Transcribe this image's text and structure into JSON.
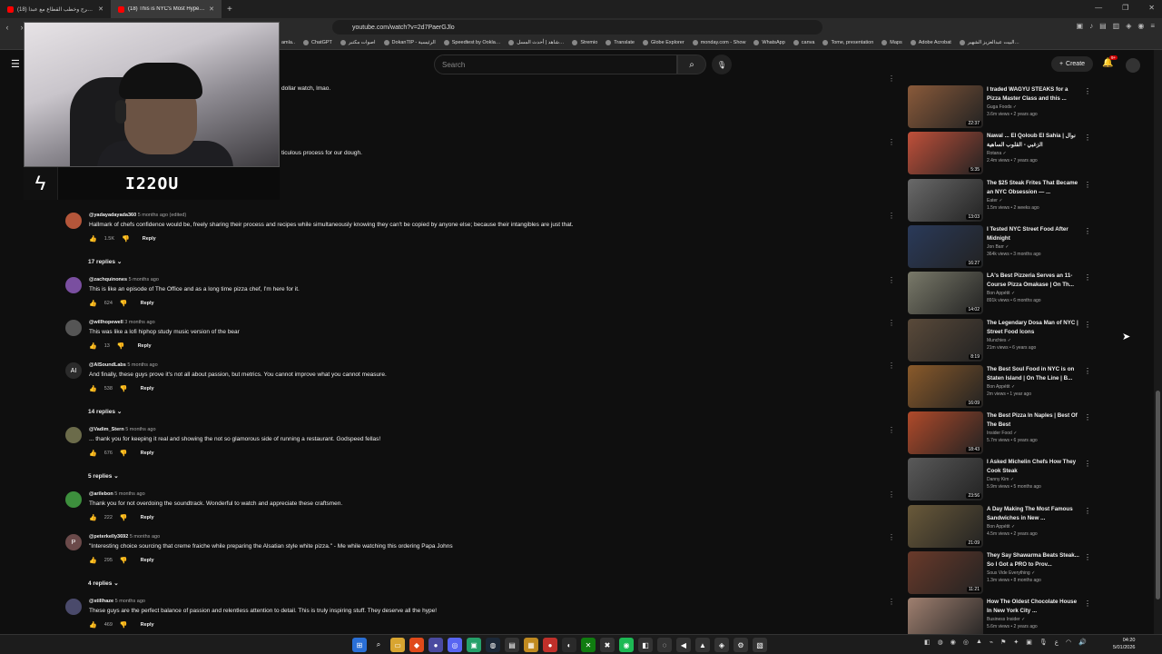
{
  "browser": {
    "tabs": [
      {
        "title": "(18) جديد بالمرج وخطب القطاع مع عبدا…",
        "active": false
      },
      {
        "title": "(18) This is NYC's Most Hyped P…",
        "active": true
      }
    ],
    "url": "youtube.com/watch?v=2d7PaerGJlo",
    "bookmarks": [
      "amla..",
      "ChatGPT",
      "اصوات مكتبر",
      "DokanTIP - الرئيسية",
      "Speedtest by Ookla…",
      "شاهد | أحدث المسل…",
      "Stremio",
      "Translate",
      "Globe Explorer",
      "monday.com - Show",
      "WhatsApp",
      "canva",
      "Tome, presentation",
      "Maps",
      "Adobe Acrobat",
      "البيت عبدالعزيز الشهير…"
    ]
  },
  "youtube": {
    "search_placeholder": "Search",
    "create_label": "Create",
    "notif_count": "9+"
  },
  "overlay": {
    "streamer_name": "I22OU"
  },
  "fragments": {
    "f1": "dollar watch, lmao.",
    "f2": "ticulous process for our dough."
  },
  "comments": [
    {
      "user": "@yadayadayada360",
      "meta": "5 months ago (edited)",
      "text": "Hallmark of chefs confidence would be, freely sharing their process and recipes while simultaneously knowing they can't be copied by anyone else; because their intangibles are just that.",
      "likes": "1.5K",
      "reply": "Reply",
      "replies": "17 replies",
      "avatar_color": "#b4563a",
      "initial": ""
    },
    {
      "user": "@zachquinones",
      "meta": "5 months ago",
      "text": "This is like an episode of The Office and as a long time pizza chef, I'm here for it.",
      "likes": "624",
      "reply": "Reply",
      "replies": "",
      "avatar_color": "#7a4fa0",
      "initial": ""
    },
    {
      "user": "@willhopewell",
      "meta": "3 months ago",
      "text": "This was like a lofi hiphop study music version of the bear",
      "likes": "13",
      "reply": "Reply",
      "replies": "",
      "avatar_color": "#555555",
      "initial": ""
    },
    {
      "user": "@AISoundLabs",
      "meta": "5 months ago",
      "text": "And finally, these guys prove it's not all about passion, but metrics. You cannot improve what you cannot measure.",
      "likes": "538",
      "reply": "Reply",
      "replies": "14 replies",
      "avatar_color": "#2b2b2b",
      "initial": "AI"
    },
    {
      "user": "@Vadim_Stern",
      "meta": "5 months ago",
      "text": "... thank you for keeping it real and showing the not so glamorous side of running a restaurant. Godspeed fellas!",
      "likes": "676",
      "reply": "Reply",
      "replies": "5 replies",
      "avatar_color": "#6b6b4a",
      "initial": ""
    },
    {
      "user": "@arilebon",
      "meta": "5 months ago",
      "text": "Thank you for not overdoing the soundtrack. Wonderful to watch and appreciate these craftsmen.",
      "likes": "222",
      "reply": "Reply",
      "replies": "",
      "avatar_color": "#3d8f3d",
      "initial": ""
    },
    {
      "user": "@peterkelly3692",
      "meta": "5 months ago",
      "text": "\"Interesting choice sourcing that creme fraiche while preparing the Alsatian style white pizza.\" - Me while watching this ordering Papa Johns",
      "likes": "295",
      "reply": "Reply",
      "replies": "4 replies",
      "avatar_color": "#6b4a4a",
      "initial": "P"
    },
    {
      "user": "@stillhaze",
      "meta": "5 months ago",
      "text": "These guys are the perfect balance of passion and relentless attention to detail. This is truly inspiring stuff. They deserve all the hype!",
      "likes": "469",
      "reply": "Reply",
      "replies": "",
      "avatar_color": "#4a4a6b",
      "initial": ""
    }
  ],
  "recommendations": [
    {
      "title": "I traded WAGYU STEAKS for a Pizza Master Class and this ...",
      "channel": "Guga Foods",
      "meta": "3.6m views • 2 years ago",
      "duration": "22:37",
      "color": "#8a5a3a"
    },
    {
      "title": "Nawal ... El Qoloub El Sahia | نوال الزغبي - القلوب الساهية",
      "channel": "Rotana",
      "meta": "2.4m views • 7 years ago",
      "duration": "5:35",
      "color": "#c0503a"
    },
    {
      "title": "The $25 Steak Frites That Became an NYC Obsession — ...",
      "channel": "Eater",
      "meta": "1.5m views • 2 weeks ago",
      "duration": "13:03",
      "color": "#6a6a6a"
    },
    {
      "title": "I Tested NYC Street Food After Midnight",
      "channel": "Jon Barr",
      "meta": "364k views • 3 months ago",
      "duration": "16:27",
      "color": "#2a3a5a"
    },
    {
      "title": "LA's Best Pizzeria Serves an 11-Course Pizza Omakase | On Th...",
      "channel": "Bon Appétit",
      "meta": "891k views • 6 months ago",
      "duration": "14:02",
      "color": "#7a7a6a"
    },
    {
      "title": "The Legendary Dosa Man of NYC | Street Food Icons",
      "channel": "Munchies",
      "meta": "21m views • 6 years ago",
      "duration": "8:19",
      "color": "#5a4a3a"
    },
    {
      "title": "The Best Soul Food in NYC is on Staten Island | On The Line | B...",
      "channel": "Bon Appétit",
      "meta": "2m views • 1 year ago",
      "duration": "16:09",
      "color": "#8a5a2a"
    },
    {
      "title": "The Best Pizza In Naples | Best Of The Best",
      "channel": "Insider Food",
      "meta": "5.7m views • 6 years ago",
      "duration": "18:43",
      "color": "#b04a2a"
    },
    {
      "title": "I Asked Michelin Chefs How They Cook Steak",
      "channel": "Danny Kim",
      "meta": "5.9m views • 5 months ago",
      "duration": "23:56",
      "color": "#5a5a5a"
    },
    {
      "title": "A Day Making The Most Famous Sandwiches in New ...",
      "channel": "Bon Appétit",
      "meta": "4.5m views • 2 years ago",
      "duration": "21:09",
      "color": "#6a5a3a"
    },
    {
      "title": "They Say Shawarma Beats Steak... So I Got a PRO to Prov...",
      "channel": "Sous Vide Everything",
      "meta": "1.3m views • 8 months ago",
      "duration": "11:21",
      "color": "#6a3a2a"
    },
    {
      "title": "How The Oldest Chocolate House In New York City ...",
      "channel": "Business Insider",
      "meta": "5.6m views • 2 years ago",
      "duration": "",
      "color": "#a08070"
    }
  ],
  "clock": {
    "time": "04:20",
    "date": "5/01/2026"
  }
}
